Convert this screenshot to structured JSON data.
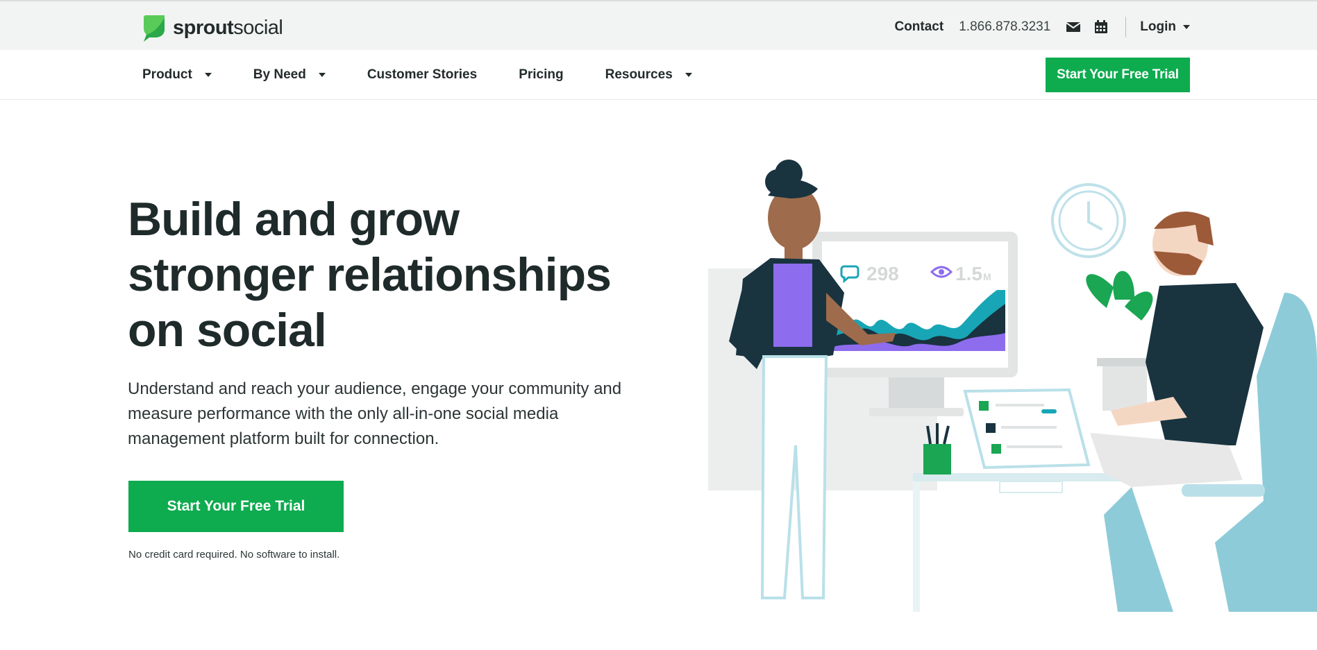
{
  "brand": {
    "logo_bold": "sprout",
    "logo_light": "social",
    "accent": "#0eab4f"
  },
  "utility": {
    "contact": "Contact",
    "phone": "1.866.878.3231",
    "mail_icon": "envelope-icon",
    "calendar_icon": "calendar-icon",
    "login": "Login"
  },
  "nav": {
    "items": [
      {
        "label": "Product",
        "dropdown": true
      },
      {
        "label": "By Need",
        "dropdown": true
      },
      {
        "label": "Customer Stories",
        "dropdown": false
      },
      {
        "label": "Pricing",
        "dropdown": false
      },
      {
        "label": "Resources",
        "dropdown": true
      }
    ],
    "cta": "Start Your Free Trial"
  },
  "hero": {
    "title": "Build and grow stronger relationships on social",
    "subtitle": "Understand and reach your audience, engage your community and measure performance with the only all-in-one social media management platform built for connection.",
    "cta": "Start Your Free Trial",
    "note": "No credit card required. No software to install."
  },
  "illustration": {
    "stat_comments": "298",
    "stat_views": "1.5",
    "stat_views_unit": "M"
  }
}
